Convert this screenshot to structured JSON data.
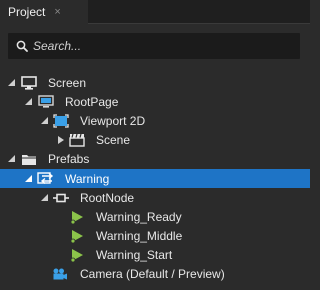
{
  "panel": {
    "tab_label": "Project",
    "close_glyph": "×"
  },
  "search": {
    "placeholder": "Search..."
  },
  "tree": {
    "nodes": [
      {
        "label": "Screen",
        "icon": "monitor-icon",
        "expanded": true
      },
      {
        "label": "RootPage",
        "icon": "page-icon",
        "expanded": true
      },
      {
        "label": "Viewport 2D",
        "icon": "viewport-icon",
        "expanded": true
      },
      {
        "label": "Scene",
        "icon": "scene-clapper-icon",
        "expanded": false
      },
      {
        "label": "Prefabs",
        "icon": "folder-icon",
        "expanded": true
      },
      {
        "label": "Warning",
        "icon": "prefab-icon",
        "expanded": true,
        "selected": true
      },
      {
        "label": "RootNode",
        "icon": "node-icon",
        "expanded": true
      },
      {
        "label": "Warning_Ready",
        "icon": "state-icon"
      },
      {
        "label": "Warning_Middle",
        "icon": "state-icon"
      },
      {
        "label": "Warning_Start",
        "icon": "state-icon"
      },
      {
        "label": "Camera (Default / Preview)",
        "icon": "camera-icon"
      }
    ]
  },
  "colors": {
    "selection": "#1e74c6",
    "state_icon": "#8bc34a",
    "accent_blue": "#3aa0e8"
  }
}
